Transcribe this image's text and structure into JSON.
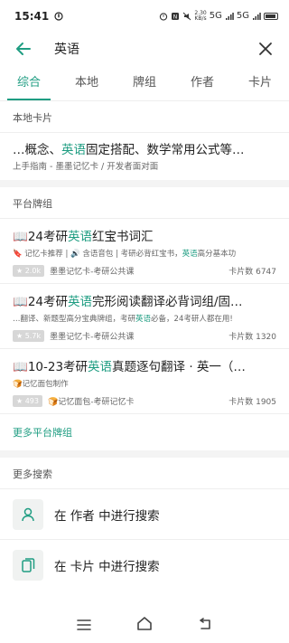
{
  "status_bar": {
    "time": "15:41",
    "speed": "2.30",
    "speed_unit": "KB/s",
    "net1": "5G",
    "net2": "5G"
  },
  "header": {
    "query": "英语"
  },
  "tabs": [
    {
      "label": "综合"
    },
    {
      "label": "本地"
    },
    {
      "label": "牌组"
    },
    {
      "label": "作者"
    },
    {
      "label": "卡片"
    }
  ],
  "local_cards": {
    "section_title": "本地卡片",
    "items": [
      {
        "title_before": "…概念、",
        "title_hl": "英语",
        "title_after": "固定搭配、数学常用公式等…",
        "subtitle": "上手指南 - 墨墨记忆卡 / 开发者面对面"
      }
    ]
  },
  "platform_decks": {
    "section_title": "平台牌组",
    "items": [
      {
        "icon": "📖",
        "title_before": "24考研",
        "title_hl": "英语",
        "title_after": "红宝书词汇",
        "desc_before": "🔖 记忆卡推荐 | 🔊 含语音包 | 考研必背红宝书，",
        "desc_hl": "英语",
        "desc_after": "高分基本功",
        "stars": "★ 2.0k",
        "author": "墨墨记忆卡-考研公共课",
        "count": "卡片数 6747"
      },
      {
        "icon": "📖",
        "title_before": "24考研",
        "title_hl": "英语",
        "title_after": "完形阅读翻译必背词组/固…",
        "desc_before": "…翻译、新题型高分宝典牌组，考研",
        "desc_hl": "英语",
        "desc_after": "必备，24考研人都在用!",
        "stars": "★ 5.7k",
        "author": "墨墨记忆卡-考研公共课",
        "count": "卡片数 1320"
      },
      {
        "icon": "📖",
        "title_before": "10-23考研",
        "title_hl": "英语",
        "title_after": "真题逐句翻译 · 英一（…",
        "desc_before": "🍞记忆面包制作",
        "desc_hl": "",
        "desc_after": "",
        "stars": "★ 493",
        "author": "🍞记忆面包-考研记忆卡",
        "count": "卡片数 1905"
      }
    ],
    "more_link": "更多平台牌组"
  },
  "more_search": {
    "title": "更多搜索",
    "author_row": "在 作者 中进行搜索",
    "card_row": "在 卡片 中进行搜索"
  },
  "colors": {
    "accent": "#1f9d82"
  }
}
